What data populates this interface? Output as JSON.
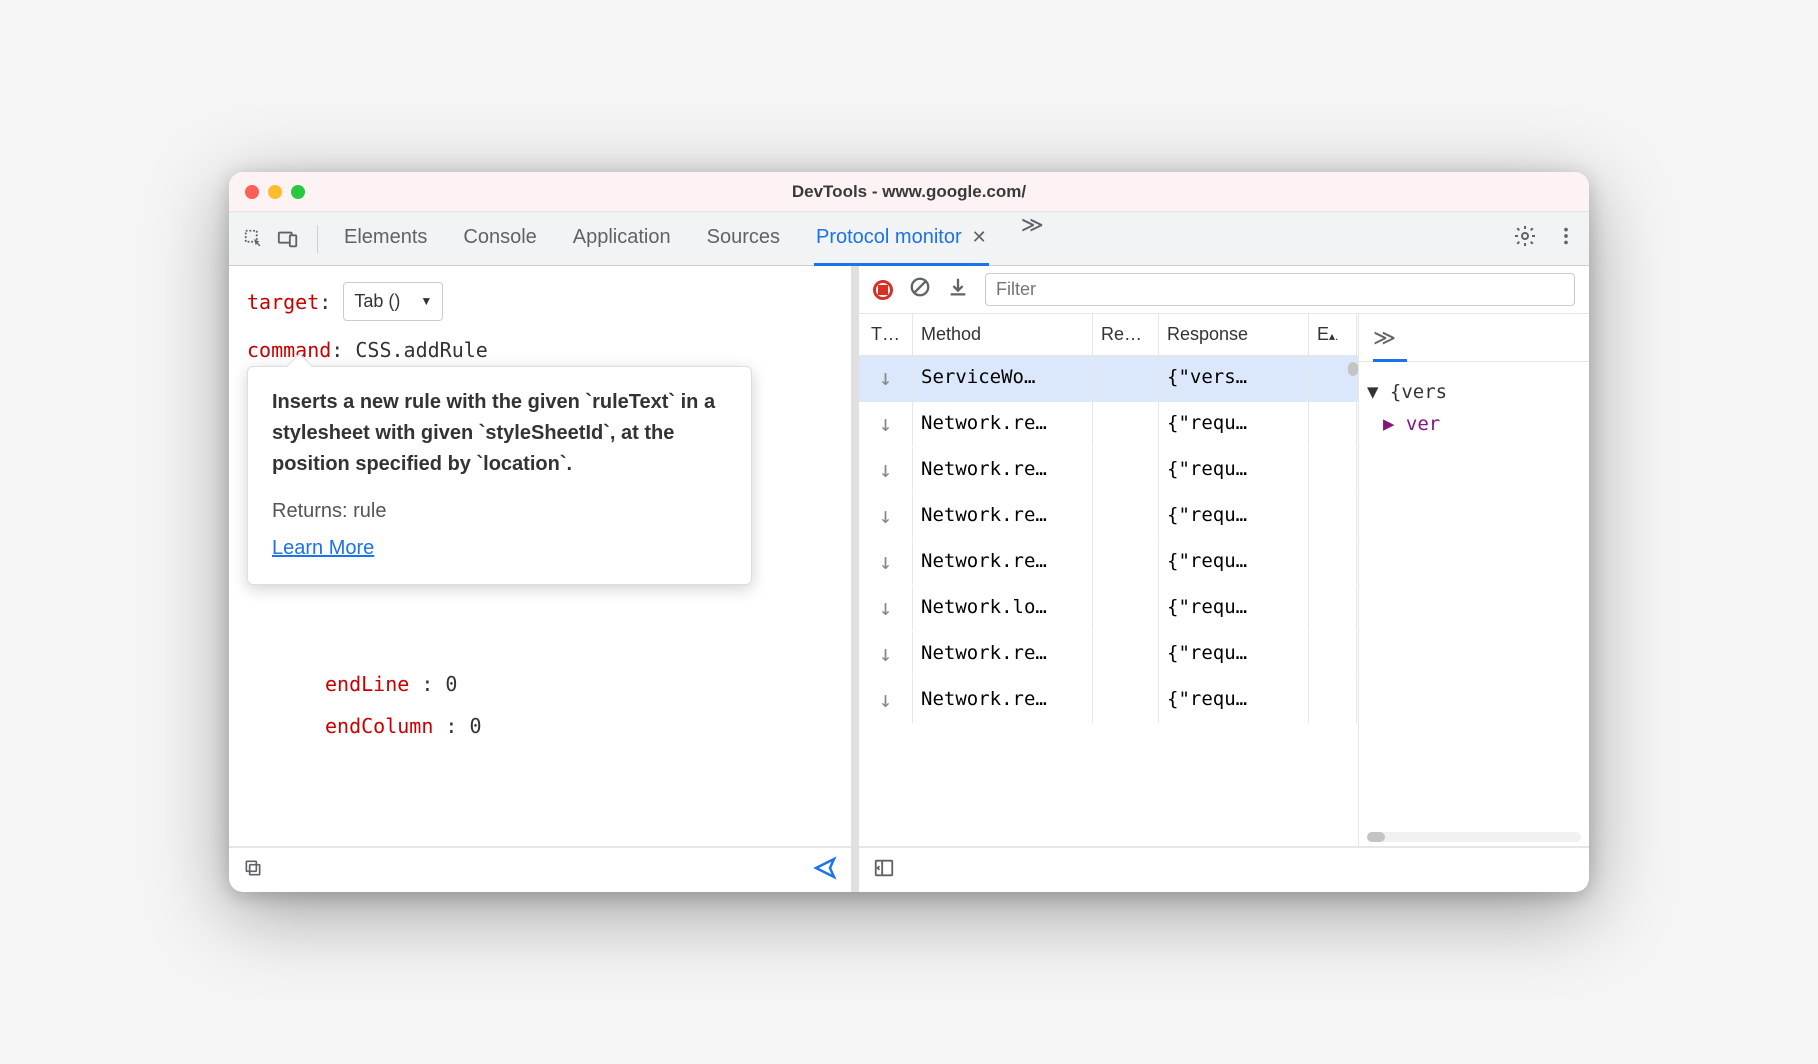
{
  "window": {
    "title": "DevTools - www.google.com/"
  },
  "toolbar": {
    "tabs": [
      "Elements",
      "Console",
      "Application",
      "Sources"
    ],
    "active_tab": "Protocol monitor"
  },
  "editor": {
    "target_label": "target",
    "target_select": "Tab ()",
    "command_label": "command",
    "command_value": "CSS.addRule",
    "params": [
      {
        "key": "endLine",
        "value": "0"
      },
      {
        "key": "endColumn",
        "value": "0"
      }
    ]
  },
  "tooltip": {
    "desc_prefix": "Inserts a new rule with the given ",
    "code1": "`ruleText`",
    "desc_mid1": " in a stylesheet with given ",
    "code2": "`styleSheetId`",
    "desc_mid2": ", at the position specified by ",
    "code3": "`location`",
    "desc_end": ".",
    "returns": "Returns: rule",
    "learn_more": "Learn More"
  },
  "right_toolbar": {
    "filter_placeholder": "Filter"
  },
  "table": {
    "headers": {
      "c1": "T…",
      "c2": "Method",
      "c3": "Re…",
      "c4": "Response",
      "c5": "E"
    },
    "rows": [
      {
        "method": "ServiceWo…",
        "response": "{\"vers…",
        "selected": true
      },
      {
        "method": "Network.re…",
        "response": "{\"requ…"
      },
      {
        "method": "Network.re…",
        "response": "{\"requ…"
      },
      {
        "method": "Network.re…",
        "response": "{\"requ…"
      },
      {
        "method": "Network.re…",
        "response": "{\"requ…"
      },
      {
        "method": "Network.lo…",
        "response": "{\"requ…"
      },
      {
        "method": "Network.re…",
        "response": "{\"requ…"
      },
      {
        "method": "Network.re…",
        "response": "{\"requ…"
      }
    ]
  },
  "detail": {
    "line1": "{vers",
    "line2": "ver"
  }
}
